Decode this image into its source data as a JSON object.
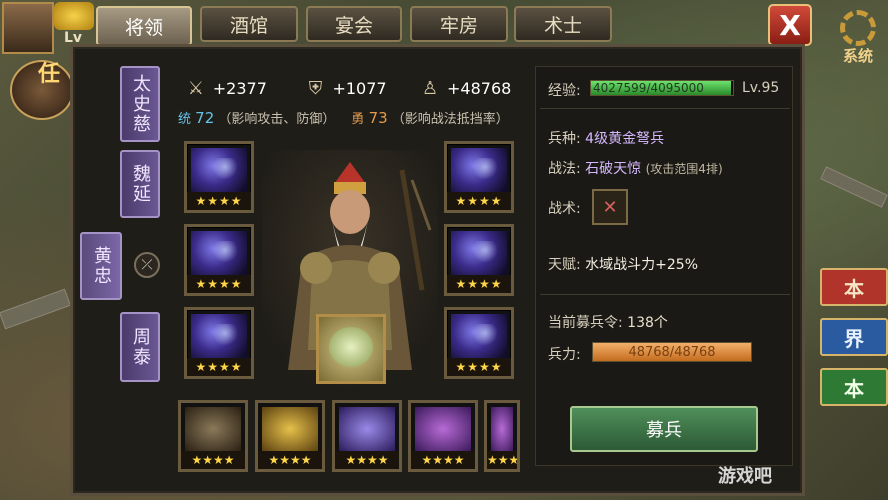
{
  "tabs": [
    {
      "label": "将领",
      "active": true
    },
    {
      "label": "酒馆",
      "active": false
    },
    {
      "label": "宴会",
      "active": false
    },
    {
      "label": "牢房",
      "active": false
    },
    {
      "label": "术士",
      "active": false
    }
  ],
  "top_left": {
    "level_prefix": "Lv",
    "event_label": "任"
  },
  "system_label": "系统",
  "close_label": "X",
  "generals": [
    {
      "name": "太史慈",
      "active": false
    },
    {
      "name": "魏延",
      "active": false
    },
    {
      "name": "黄忠",
      "active": true
    },
    {
      "name": "周泰",
      "active": false
    }
  ],
  "stats": {
    "attack": "+2377",
    "defense": "+1077",
    "troops": "+48768"
  },
  "sub_stats": {
    "tong_label": "统",
    "tong_value": "72",
    "tong_note": "（影响攻击、防御）",
    "yong_label": "勇",
    "yong_value": "73",
    "yong_note": "（影响战法抵挡率）"
  },
  "slot_stars": "★★★★",
  "info": {
    "exp_label": "经验:",
    "exp_text": "4027599/4095000",
    "exp_fraction": 0.9835,
    "level": "Lv.95",
    "unit_label": "兵种:",
    "unit_value": "4级黄金弩兵",
    "tactic_label": "战法:",
    "tactic_value": "石破天惊",
    "tactic_note": "(攻击范围4排)",
    "skill_label": "战术:",
    "talent_label": "天赋:",
    "talent_value": "水域战斗力+25%",
    "recruit_order_label": "当前募兵令:",
    "recruit_order_value": "138个",
    "troop_label": "兵力:",
    "troop_text": "48768/48768",
    "troop_fraction": 1.0,
    "recruit_button": "募兵"
  },
  "side_right": [
    {
      "label": "本",
      "color": "#b0342a"
    },
    {
      "label": "界",
      "color": "#2a5aa0"
    },
    {
      "label": "本",
      "color": "#2e7a34"
    }
  ],
  "watermark": "游戏吧"
}
